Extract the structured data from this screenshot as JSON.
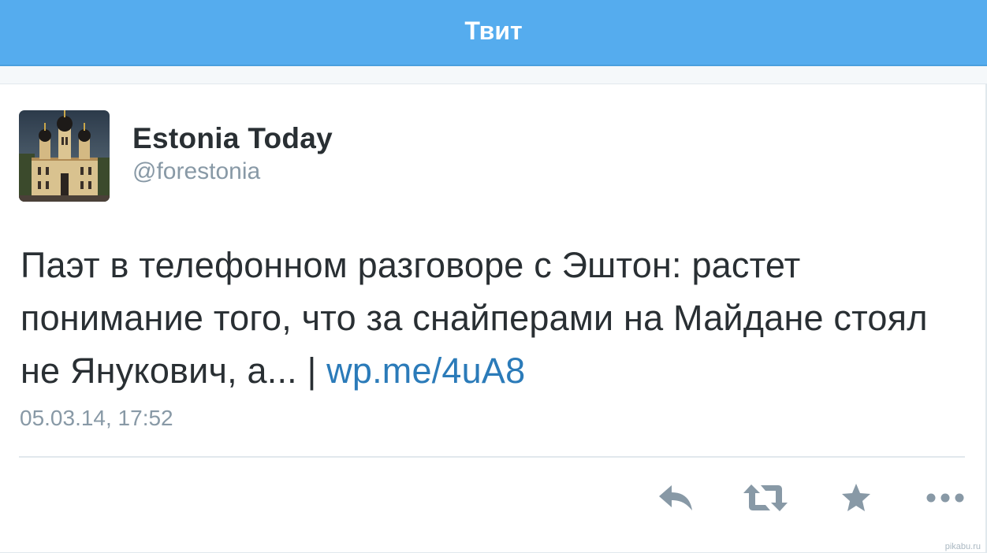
{
  "header": {
    "title": "Твит"
  },
  "tweet": {
    "author_name": "Estonia Today",
    "author_handle": "@forestonia",
    "text": "Паэт в телефонном разговоре с Эштон: растет понимание того, что за снайперами на Майдане стоял не Янукович, а... | ",
    "link": "wp.me/4uA8",
    "timestamp": "05.03.14, 17:52"
  },
  "actions": [
    {
      "name": "reply",
      "icon": "reply-icon"
    },
    {
      "name": "retweet",
      "icon": "retweet-icon"
    },
    {
      "name": "favorite",
      "icon": "star-icon"
    },
    {
      "name": "more",
      "icon": "more-icon"
    }
  ],
  "watermark": "pikabu.ru",
  "colors": {
    "nav_bg": "#55acee",
    "link": "#2b7bb9",
    "text": "#292f33",
    "muted": "#8899a6",
    "icon": "#8899a6"
  }
}
